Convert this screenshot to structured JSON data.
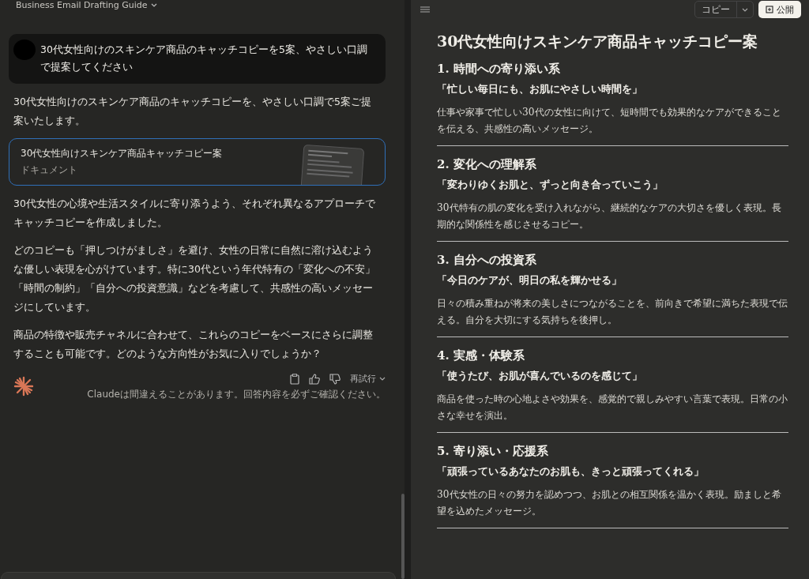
{
  "header": {
    "title": "Business Email Drafting Guide"
  },
  "chat": {
    "user_message": "30代女性向けのスキンケア商品のキャッチコピーを5案、やさしい口調で提案してください",
    "intro": "30代女性向けのスキンケア商品のキャッチコピーを、やさしい口調で5案ご提案いたします。",
    "artifact": {
      "title": "30代女性向けスキンケア商品キャッチコピー案",
      "subtitle": "ドキュメント",
      "selected": true
    },
    "paragraphs": [
      "30代女性の心境や生活スタイルに寄り添うよう、それぞれ異なるアプローチでキャッチコピーを作成しました。",
      "どのコピーも「押しつけがましさ」を避け、女性の日常に自然に溶け込むような優しい表現を心がけています。特に30代という年代特有の「変化への不安」「時間の制約」「自分への投資意識」などを考慮して、共感性の高いメッセージにしています。",
      "商品の特徴や販売チャネルに合わせて、これらのコピーをベースにさらに調整することも可能です。どのような方向性がお気に入りでしょうか？"
    ],
    "retry": "再試行",
    "disclaimer": "Claudeは間違えることがあります。回答内容を必ずご確認ください。"
  },
  "document": {
    "copy_button": "コピー",
    "publish_button": "公開",
    "title": "30代女性向けスキンケア商品キャッチコピー案",
    "sections": [
      {
        "heading": "1. 時間への寄り添い系",
        "tagline": "「忙しい毎日にも、お肌にやさしい時間を」",
        "body": "仕事や家事で忙しい30代の女性に向けて、短時間でも効果的なケアができることを伝える、共感性の高いメッセージ。"
      },
      {
        "heading": "2. 変化への理解系",
        "tagline": "「変わりゆくお肌と、ずっと向き合っていこう」",
        "body": "30代特有の肌の変化を受け入れながら、継続的なケアの大切さを優しく表現。長期的な関係性を感じさせるコピー。"
      },
      {
        "heading": "3. 自分への投資系",
        "tagline": "「今日のケアが、明日の私を輝かせる」",
        "body": "日々の積み重ねが将来の美しさにつながることを、前向きで希望に満ちた表現で伝える。自分を大切にする気持ちを後押し。"
      },
      {
        "heading": "4. 実感・体験系",
        "tagline": "「使うたび、お肌が喜んでいるのを感じて」",
        "body": "商品を使った時の心地よさや効果を、感覚的で親しみやすい言葉で表現。日常の小さな幸せを演出。"
      },
      {
        "heading": "5. 寄り添い・応援系",
        "tagline": "「頑張っているあなたのお肌も、きっと頑張ってくれる」",
        "body": "30代女性の日々の努力を認めつつ、お肌との相互関係を温かく表現。励ましと希望を込めたメッセージ。"
      }
    ]
  }
}
